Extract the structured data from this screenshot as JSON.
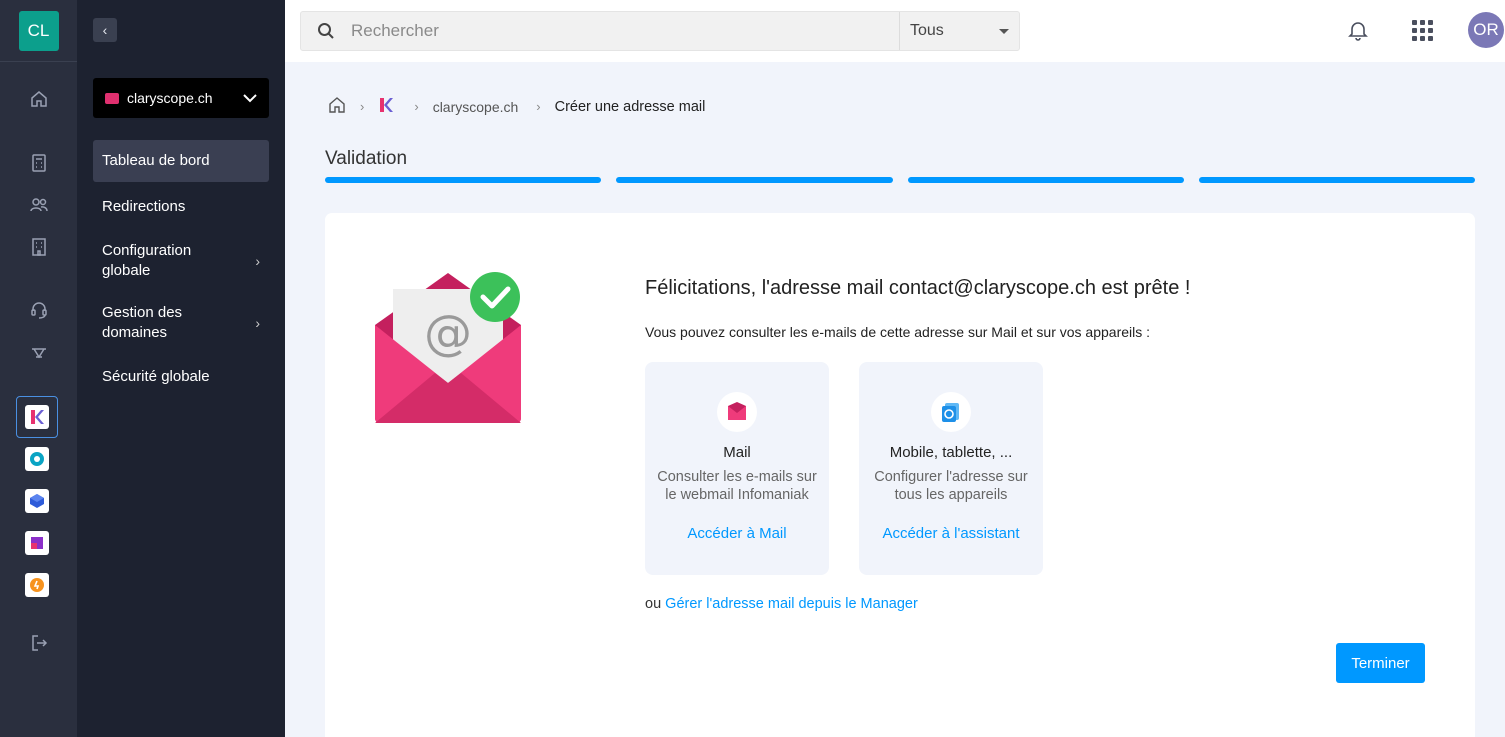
{
  "account": {
    "initials": "CL"
  },
  "user": {
    "initials": "OR"
  },
  "topbar": {
    "search_placeholder": "Rechercher",
    "scope_value": "Tous"
  },
  "subnav": {
    "domain": "claryscope.ch",
    "items": [
      {
        "label": "Tableau de bord"
      },
      {
        "label": "Redirections"
      },
      {
        "label": "Configuration globale"
      },
      {
        "label": "Gestion des domaines"
      },
      {
        "label": "Sécurité globale"
      }
    ]
  },
  "breadcrumb": {
    "domain": "claryscope.ch",
    "current": "Créer une adresse mail"
  },
  "step": {
    "title": "Validation",
    "segments_completed": 4,
    "segments_total": 4
  },
  "card": {
    "headline": "Félicitations, l'adresse mail contact@claryscope.ch est prête !",
    "subline": "Vous pouvez consulter les e-mails de cette adresse sur Mail et sur vos appareils :",
    "options": [
      {
        "title": "Mail",
        "description": "Consulter les e-mails sur le webmail Infomaniak",
        "link": "Accéder à Mail",
        "icon": "mail-app-icon"
      },
      {
        "title": "Mobile, tablette, ...",
        "description": "Configurer l'adresse sur tous les appareils",
        "link": "Accéder à l'assistant",
        "icon": "sync-devices-icon"
      }
    ],
    "manager_prefix": "ou",
    "manager_link": "Gérer l'adresse mail depuis le Manager",
    "finish_label": "Terminer"
  },
  "colors": {
    "accent": "#0098ff",
    "brand_pink": "#e8326f",
    "success": "#3cc15a",
    "rail": "#2a2f3e",
    "subnav": "#1d2230"
  }
}
